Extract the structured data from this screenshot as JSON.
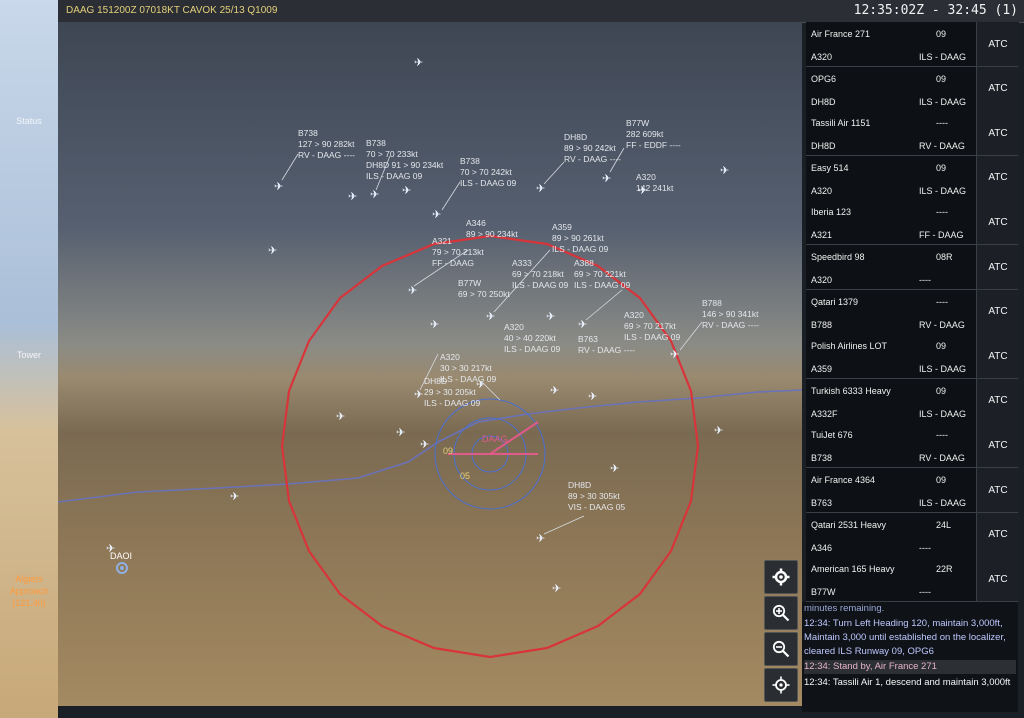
{
  "sidebar": {
    "tabs": [
      {
        "label": "Status"
      },
      {
        "label": "Tower"
      },
      {
        "label": "Algiers Approach (121.40)"
      }
    ]
  },
  "topbar": {
    "metar": "DAAG 151200Z 07018KT CAVOK 25/13 Q1009",
    "clock": "12:35:02Z - 32:45 (1)"
  },
  "scope": {
    "airport_label": "DAAG",
    "secondary_airport": "DAOI",
    "runway_labels": [
      "09",
      "05"
    ],
    "data_blocks": [
      {
        "lines": [
          "B738",
          "127 > 90 282kt",
          "RV - DAAG ----"
        ]
      },
      {
        "lines": [
          "B738",
          "70 > 70 233kt",
          "DH8D 91 > 90 234kt",
          "ILS - DAAG 09"
        ]
      },
      {
        "lines": [
          "B738",
          "70 > 70 242kt",
          "ILS - DAAG 09"
        ]
      },
      {
        "lines": [
          "DH8D",
          "89 > 90 242kt",
          "RV - DAAG ----"
        ]
      },
      {
        "lines": [
          "B77W",
          "282 609kt",
          "FF - EDDF ----"
        ]
      },
      {
        "lines": [
          "A320",
          "142 241kt"
        ]
      },
      {
        "lines": [
          "A346",
          "89 > 90 234kt"
        ]
      },
      {
        "lines": [
          "A321",
          "79 > 70 213kt",
          "FF - DAAG"
        ]
      },
      {
        "lines": [
          "A359",
          "89 > 90 261kt",
          "ILS - DAAG 09"
        ]
      },
      {
        "lines": [
          "A388",
          "69 > 70 221kt",
          "ILS - DAAG 09"
        ]
      },
      {
        "lines": [
          "A333",
          "69 > 70 218kt",
          "ILS - DAAG 09"
        ]
      },
      {
        "lines": [
          "B77W",
          "69 > 70 250kt"
        ]
      },
      {
        "lines": [
          "B788",
          "146 > 90 341kt",
          "RV - DAAG ----"
        ]
      },
      {
        "lines": [
          "A320",
          "69 > 70 217kt",
          "ILS - DAAG 09"
        ]
      },
      {
        "lines": [
          "A320",
          "40 > 40 220kt",
          "ILS - DAAG 09"
        ]
      },
      {
        "lines": [
          "A320",
          "30 > 30 217kt",
          "ILS - DAAG 09"
        ]
      },
      {
        "lines": [
          "B763",
          "RV - DAAG ----"
        ]
      },
      {
        "lines": [
          "DH8D",
          "29 > 30 205kt",
          "ILS - DAAG 09"
        ]
      },
      {
        "lines": [
          "DH8D",
          "89 > 30 305kt",
          "VIS - DAAG 05"
        ]
      }
    ]
  },
  "strips": [
    {
      "callsign": "Air France 271",
      "runway": "09",
      "type": "A320",
      "route": "ILS - DAAG",
      "atc": "ATC"
    },
    {
      "callsign": "OPG6",
      "runway": "09",
      "type": "DH8D",
      "route": "ILS - DAAG",
      "atc": "ATC"
    },
    {
      "callsign": "Tassili Air 1151",
      "runway": "----",
      "type": "DH8D",
      "route": "RV - DAAG",
      "atc": "ATC"
    },
    {
      "callsign": "Easy 514",
      "runway": "09",
      "type": "A320",
      "route": "ILS - DAAG",
      "atc": "ATC"
    },
    {
      "callsign": "Iberia 123",
      "runway": "----",
      "type": "A321",
      "route": "FF - DAAG",
      "atc": "ATC"
    },
    {
      "callsign": "Speedbird 98",
      "runway": "08R",
      "type": "A320",
      "route": "----",
      "atc": "ATC"
    },
    {
      "callsign": "Qatari 1379",
      "runway": "----",
      "type": "B788",
      "route": "RV - DAAG",
      "atc": "ATC"
    },
    {
      "callsign": "Polish Airlines LOT",
      "runway": "09",
      "type": "A359",
      "route": "ILS - DAAG",
      "atc": "ATC"
    },
    {
      "callsign": "Turkish 6333 Heavy",
      "runway": "09",
      "type": "A332F",
      "route": "ILS - DAAG",
      "atc": "ATC"
    },
    {
      "callsign": "TuiJet 676",
      "runway": "----",
      "type": "B738",
      "route": "RV - DAAG",
      "atc": "ATC"
    },
    {
      "callsign": "Air France 4364",
      "runway": "09",
      "type": "B763",
      "route": "ILS - DAAG",
      "atc": "ATC"
    },
    {
      "callsign": "Qatari 2531 Heavy",
      "runway": "24L",
      "type": "A346",
      "route": "----",
      "atc": "ATC"
    },
    {
      "callsign": "American 165 Heavy",
      "runway": "22R",
      "type": "B77W",
      "route": "----",
      "atc": "ATC"
    }
  ],
  "tools": [
    {
      "icon": "gear-icon"
    },
    {
      "icon": "zoom-in-icon"
    },
    {
      "icon": "zoom-out-icon"
    },
    {
      "icon": "recenter-icon"
    }
  ],
  "log": {
    "lines": [
      {
        "text": "minutes remaining.",
        "style": "faded"
      },
      {
        "text": "12:34: Turn Left Heading 120, maintain 3,000ft, Maintain 3,000 until established on the localizer, cleared ILS Runway 09, OPG6",
        "style": "blue"
      },
      {
        "text": "12:34: Stand by, Air France 271",
        "style": "pink"
      },
      {
        "text": "12:34: Tassili Air 1, descend and maintain 3,000ft",
        "style": "white"
      }
    ]
  },
  "colors": {
    "accent_orange": "#ff9a3d",
    "metar_yellow": "#e3cf7a",
    "range_ring_red": "#d8343a"
  }
}
